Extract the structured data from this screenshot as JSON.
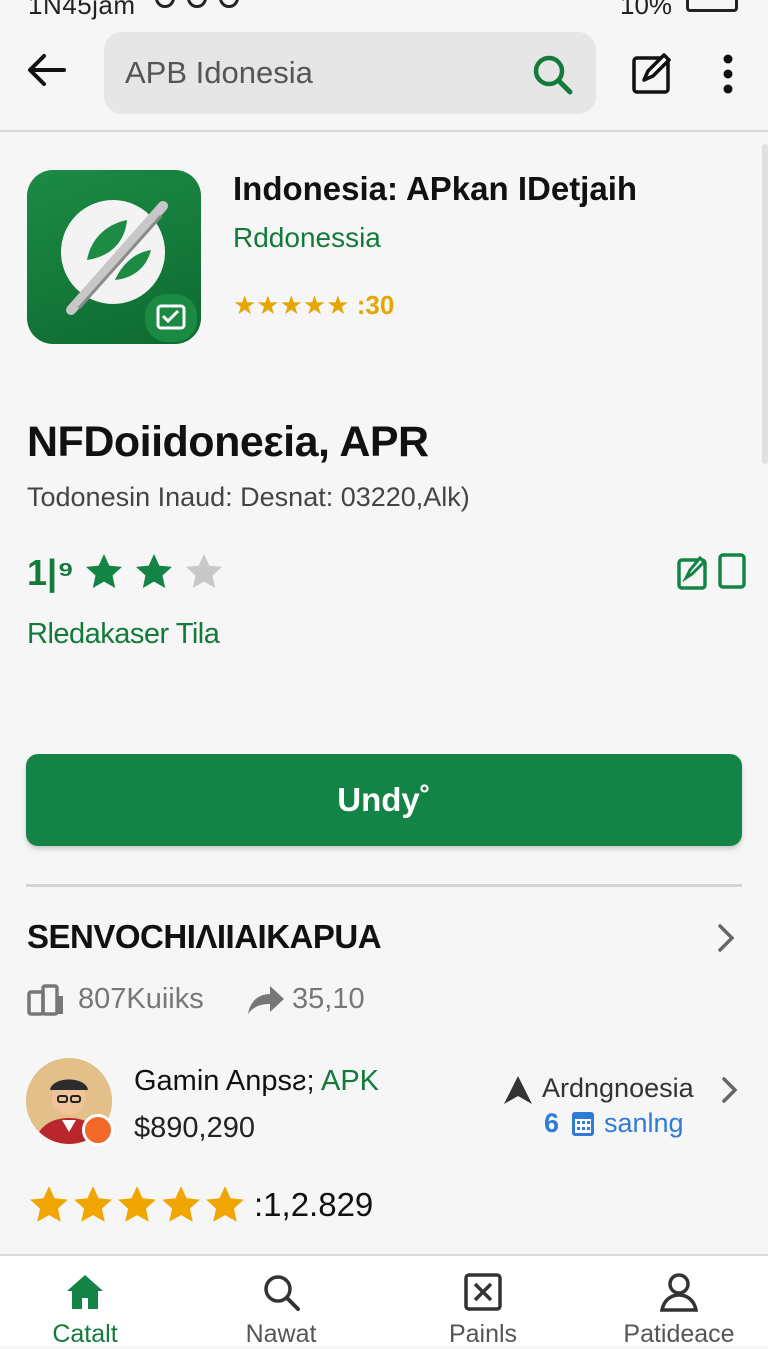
{
  "status_bar": {
    "time": "1N45jam",
    "battery": "10%"
  },
  "search": {
    "query": "APB Idonesia"
  },
  "app": {
    "title": "Indonesia: APkan IDetjaih",
    "developer": "Rddonessia",
    "rating_text": "★★★★★ :30",
    "rating_value": 5,
    "name": "NFDoiidoneεia, APR",
    "subline": "Todonesin Inaud: Desnat: 03220,Alk)",
    "rating_num": "1|⁹",
    "rating_stars_filled": 2,
    "rating_stars_total": 3,
    "release_label": "Rledakaser Tila"
  },
  "install_button": {
    "label": "Undy˚"
  },
  "section": {
    "title": "SENVOCHIΛIIAIKAPUA",
    "stat1": "807Kuiiks",
    "stat2": "35,10"
  },
  "developer_card": {
    "name": "Gamin Anpsƨ;",
    "name_suffix": "APK",
    "price": "$890,290",
    "right_label": "Ardngnoesia",
    "count": "6",
    "sub_label": "sanlng",
    "stars": 5,
    "rating_text": ":1,2.829"
  },
  "bottom_nav": [
    {
      "label": "Catalt",
      "icon": "home-icon",
      "active": true
    },
    {
      "label": "Nawat",
      "icon": "search-icon",
      "active": false
    },
    {
      "label": "Painls",
      "icon": "close-box-icon",
      "active": false
    },
    {
      "label": "Patideace",
      "icon": "person-icon",
      "active": false
    }
  ],
  "colors": {
    "accent": "#138446",
    "accent_text": "#137a3a",
    "star": "#f0a500",
    "link": "#2f7bd5"
  }
}
